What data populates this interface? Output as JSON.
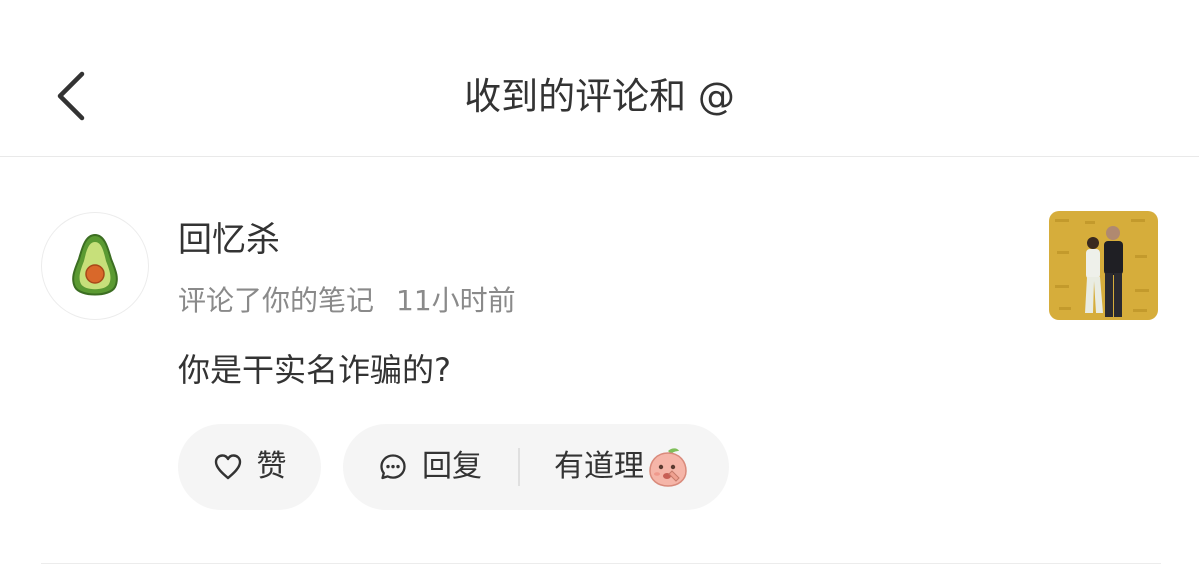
{
  "header": {
    "title": "收到的评论和 @",
    "back_icon": "chevron-left-icon"
  },
  "comment": {
    "username": "回忆杀",
    "action_text": "评论了你的笔记",
    "time": "11小时前",
    "text": "你是干实名诈骗的?",
    "avatar_icon": "avocado-icon",
    "thumbnail_icon": "note-photo-thumbnail"
  },
  "actions": {
    "like_label": "赞",
    "reply_label": "回复",
    "quick_reply_label": "有道理",
    "like_icon": "heart-outline-icon",
    "reply_icon": "chat-bubble-icon",
    "quick_reply_emoji": "peach-emoji-icon"
  },
  "colors": {
    "text_primary": "#333333",
    "text_secondary": "#8a8a8a",
    "pill_background": "#f5f5f5",
    "divider": "#e9e9e9",
    "thumbnail_gold": "#d6ad3b"
  }
}
